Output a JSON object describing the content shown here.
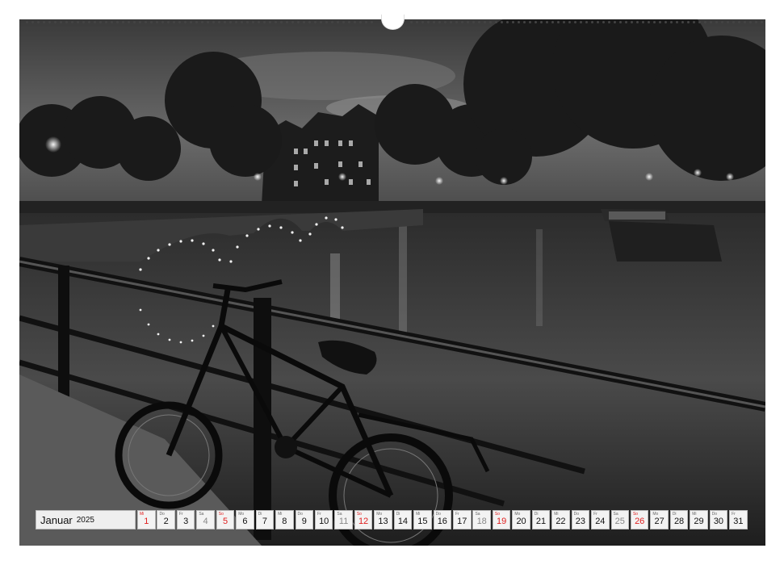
{
  "calendar": {
    "month": "Januar",
    "year": "2025",
    "days": [
      {
        "wd": "Mi",
        "n": "1",
        "type": "holiday"
      },
      {
        "wd": "Do",
        "n": "2",
        "type": "day"
      },
      {
        "wd": "Fr",
        "n": "3",
        "type": "day"
      },
      {
        "wd": "Sa",
        "n": "4",
        "type": "sat"
      },
      {
        "wd": "So",
        "n": "5",
        "type": "sun"
      },
      {
        "wd": "Mo",
        "n": "6",
        "type": "day"
      },
      {
        "wd": "Di",
        "n": "7",
        "type": "day"
      },
      {
        "wd": "Mi",
        "n": "8",
        "type": "day"
      },
      {
        "wd": "Do",
        "n": "9",
        "type": "day"
      },
      {
        "wd": "Fr",
        "n": "10",
        "type": "day"
      },
      {
        "wd": "Sa",
        "n": "11",
        "type": "sat"
      },
      {
        "wd": "So",
        "n": "12",
        "type": "sun"
      },
      {
        "wd": "Mo",
        "n": "13",
        "type": "day"
      },
      {
        "wd": "Di",
        "n": "14",
        "type": "day"
      },
      {
        "wd": "Mi",
        "n": "15",
        "type": "day"
      },
      {
        "wd": "Do",
        "n": "16",
        "type": "day"
      },
      {
        "wd": "Fr",
        "n": "17",
        "type": "day"
      },
      {
        "wd": "Sa",
        "n": "18",
        "type": "sat"
      },
      {
        "wd": "So",
        "n": "19",
        "type": "sun"
      },
      {
        "wd": "Mo",
        "n": "20",
        "type": "day"
      },
      {
        "wd": "Di",
        "n": "21",
        "type": "day"
      },
      {
        "wd": "Mi",
        "n": "22",
        "type": "day"
      },
      {
        "wd": "Do",
        "n": "23",
        "type": "day"
      },
      {
        "wd": "Fr",
        "n": "24",
        "type": "day"
      },
      {
        "wd": "Sa",
        "n": "25",
        "type": "sat"
      },
      {
        "wd": "So",
        "n": "26",
        "type": "sun"
      },
      {
        "wd": "Mo",
        "n": "27",
        "type": "day"
      },
      {
        "wd": "Di",
        "n": "28",
        "type": "day"
      },
      {
        "wd": "Mi",
        "n": "29",
        "type": "day"
      },
      {
        "wd": "Do",
        "n": "30",
        "type": "day"
      },
      {
        "wd": "Fr",
        "n": "31",
        "type": "day"
      }
    ]
  },
  "colors": {
    "sunday": "#e02020",
    "saturday": "#888888",
    "cell_bg": "#f3f3f3"
  }
}
